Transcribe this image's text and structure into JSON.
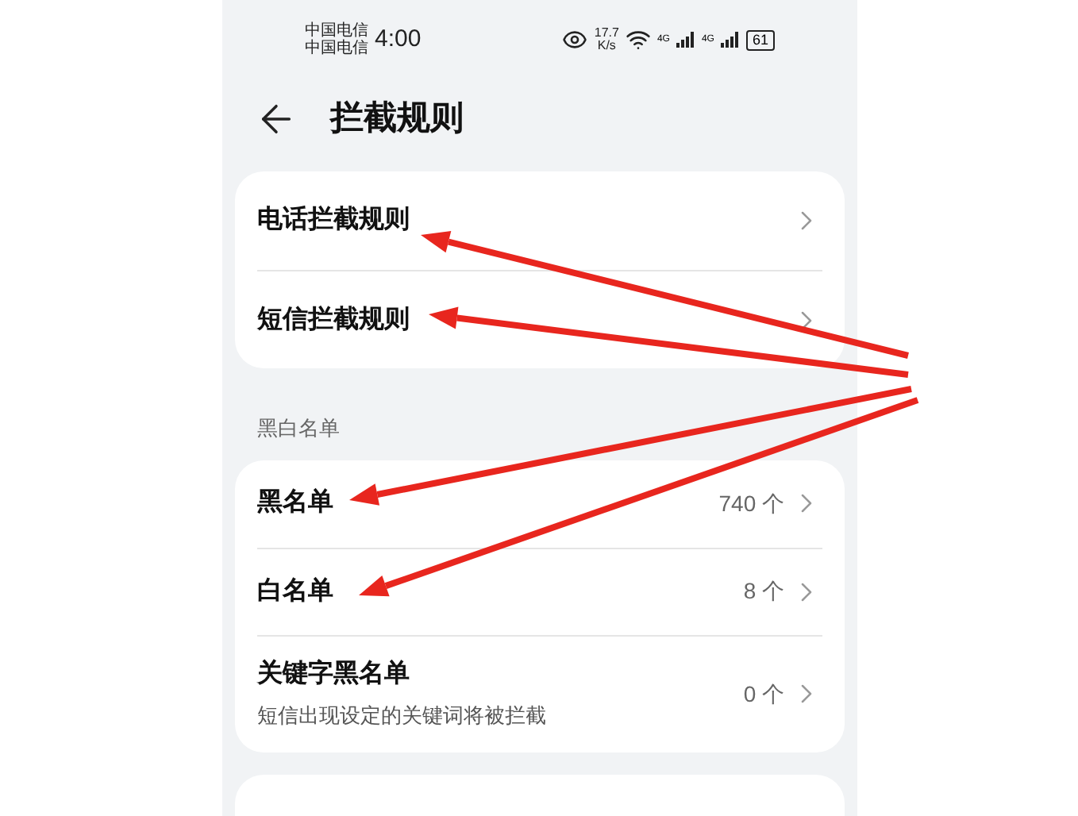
{
  "status_bar": {
    "carriers": [
      "中国电信",
      "中国电信"
    ],
    "time": "4:00",
    "speed": "17.7",
    "speed_unit": "K/s",
    "network_1": "4G",
    "network_2": "4G",
    "battery": "61"
  },
  "header": {
    "title": "拦截规则"
  },
  "rule_items": [
    {
      "label": "电话拦截规则"
    },
    {
      "label": "短信拦截规则"
    }
  ],
  "section_title": "黑白名单",
  "list_items": [
    {
      "label": "黑名单",
      "count": "740 个"
    },
    {
      "label": "白名单",
      "count": "8 个"
    },
    {
      "label": "关键字黑名单",
      "description": "短信出现设定的关键词将被拦截",
      "count": "0 个"
    }
  ]
}
